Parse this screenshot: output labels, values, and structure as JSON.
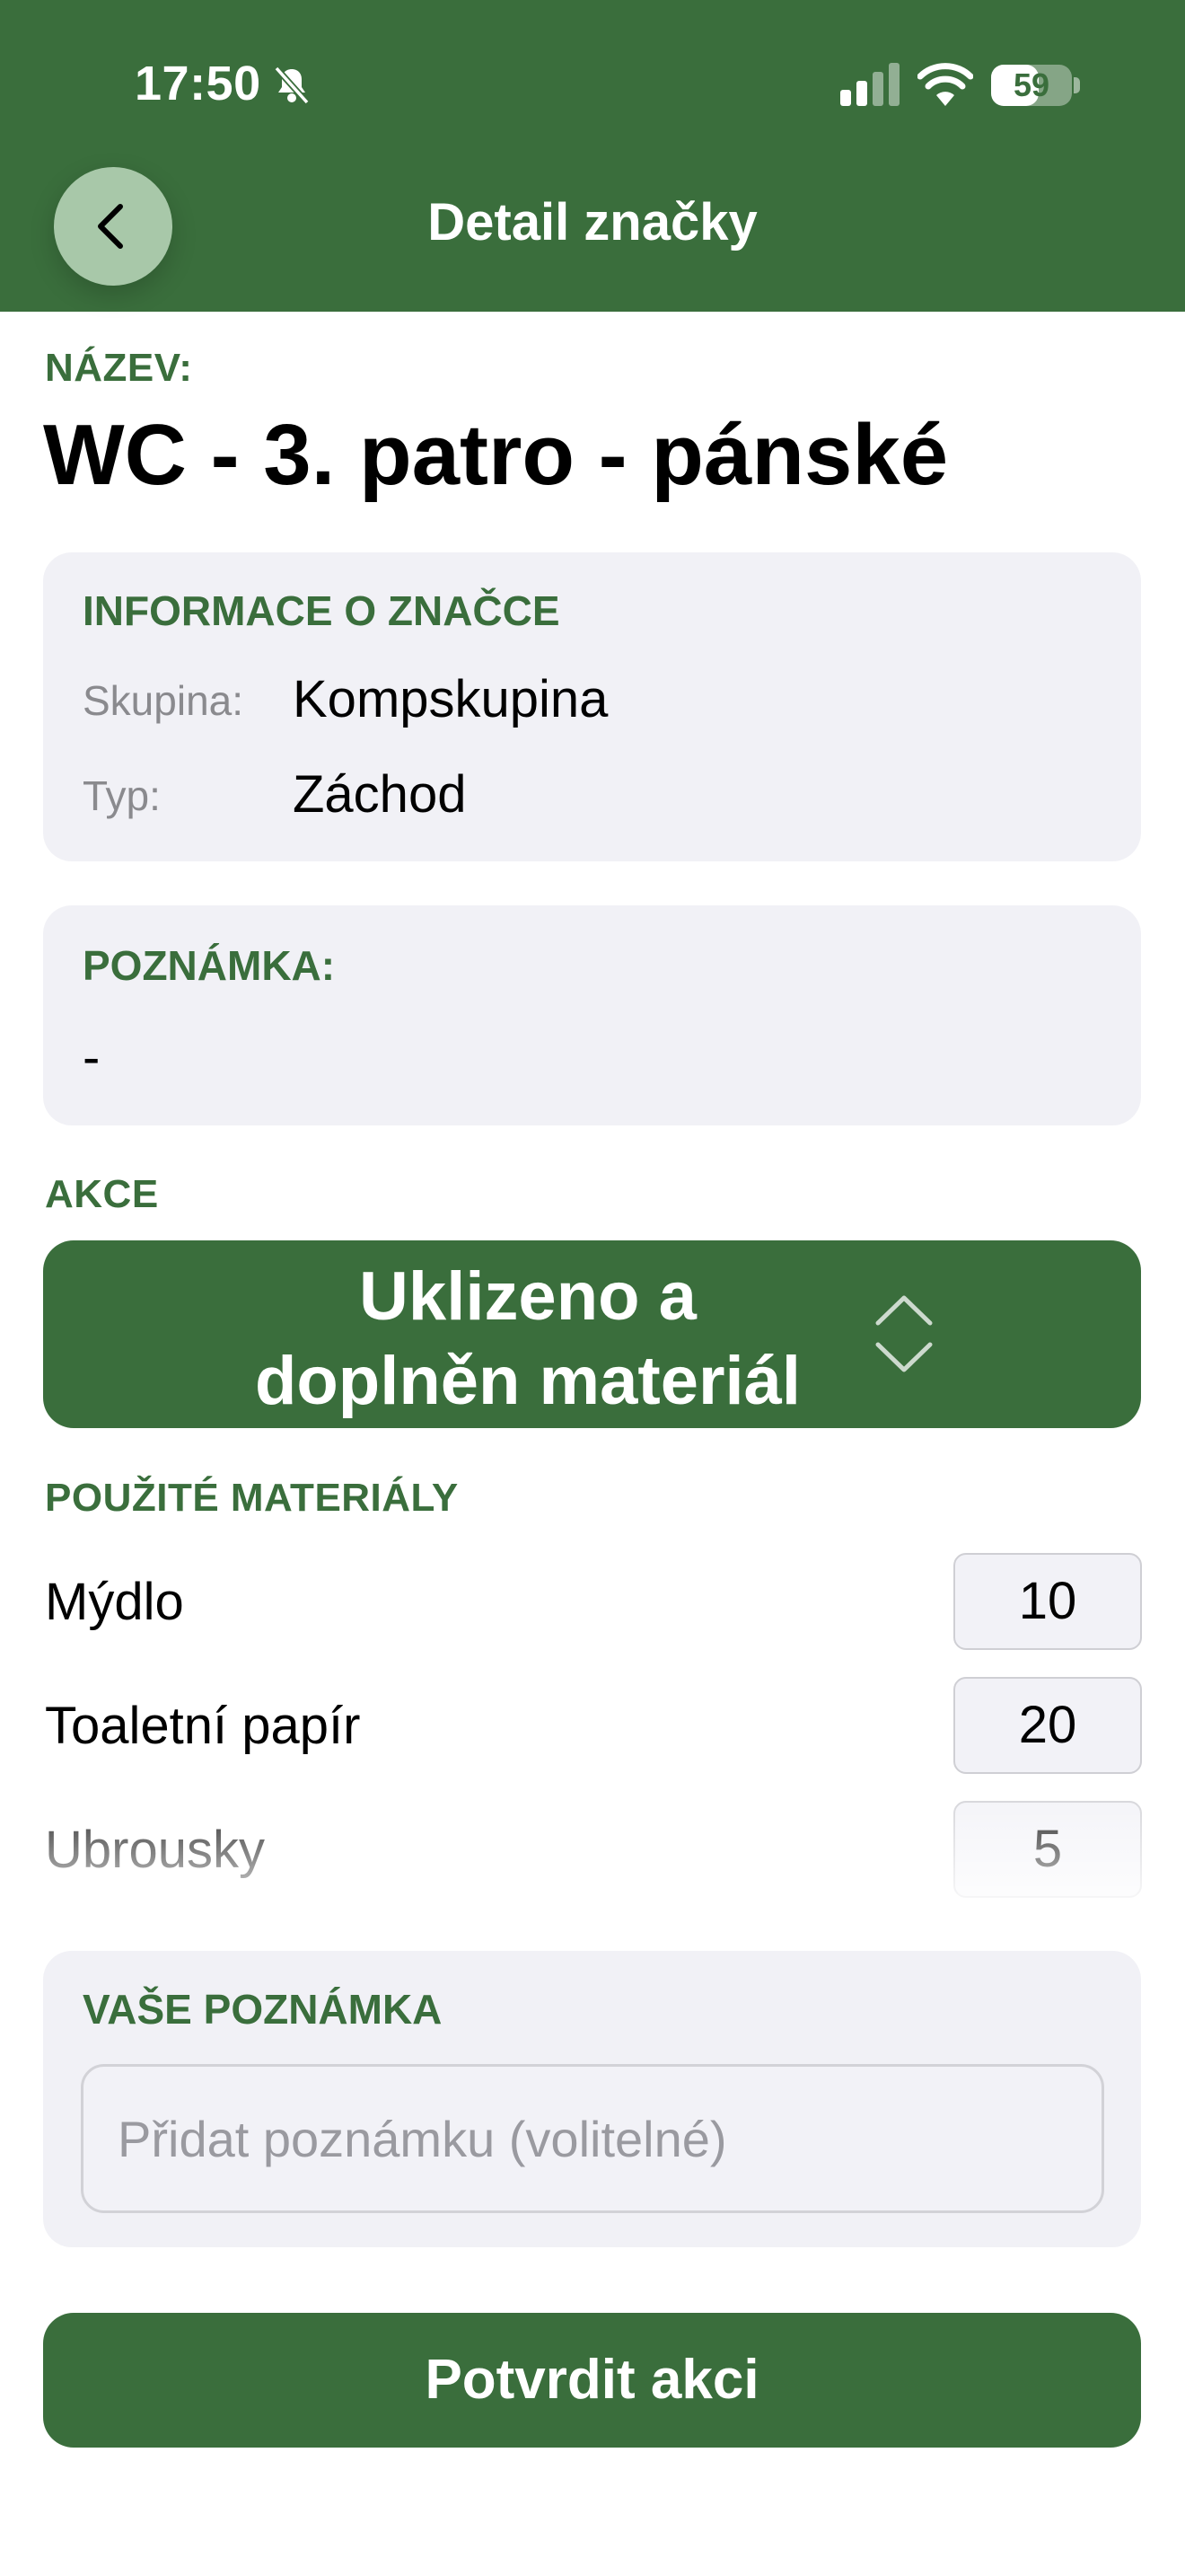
{
  "status_bar": {
    "time": "17:50",
    "battery": "59",
    "battery_level": 0.59
  },
  "header": {
    "title": "Detail značky",
    "back_icon": "chevron-left-icon"
  },
  "name": {
    "label": "NÁZEV:",
    "value": "WC - 3. patro - pánské"
  },
  "info_card": {
    "title": "INFORMACE O ZNAČCE",
    "group_label": "Skupina:",
    "group_value": "Kompskupina",
    "type_label": "Typ:",
    "type_value": "Záchod"
  },
  "note_card": {
    "title": "POZNÁMKA:",
    "value": "-"
  },
  "action": {
    "label": "AKCE",
    "selected_line1": "Uklizeno a",
    "selected_line2": "doplněn materiál",
    "icon": "chevron-up-down-icon"
  },
  "materials": {
    "label": "POUŽITÉ MATERIÁLY",
    "items": [
      {
        "name": "Mýdlo",
        "quantity": "10"
      },
      {
        "name": "Toaletní papír",
        "quantity": "20"
      },
      {
        "name": "Ubrousky",
        "quantity": "5"
      }
    ]
  },
  "user_note": {
    "title": "VAŠE POZNÁMKA",
    "placeholder": "Přidat poznámku (volitelné)",
    "value": ""
  },
  "confirm_button": "Potvrdit akci",
  "colors": {
    "brand_green": "#3a6e3c",
    "card_background": "#f1f1f6",
    "back_button_bg": "#a8c8a9"
  }
}
